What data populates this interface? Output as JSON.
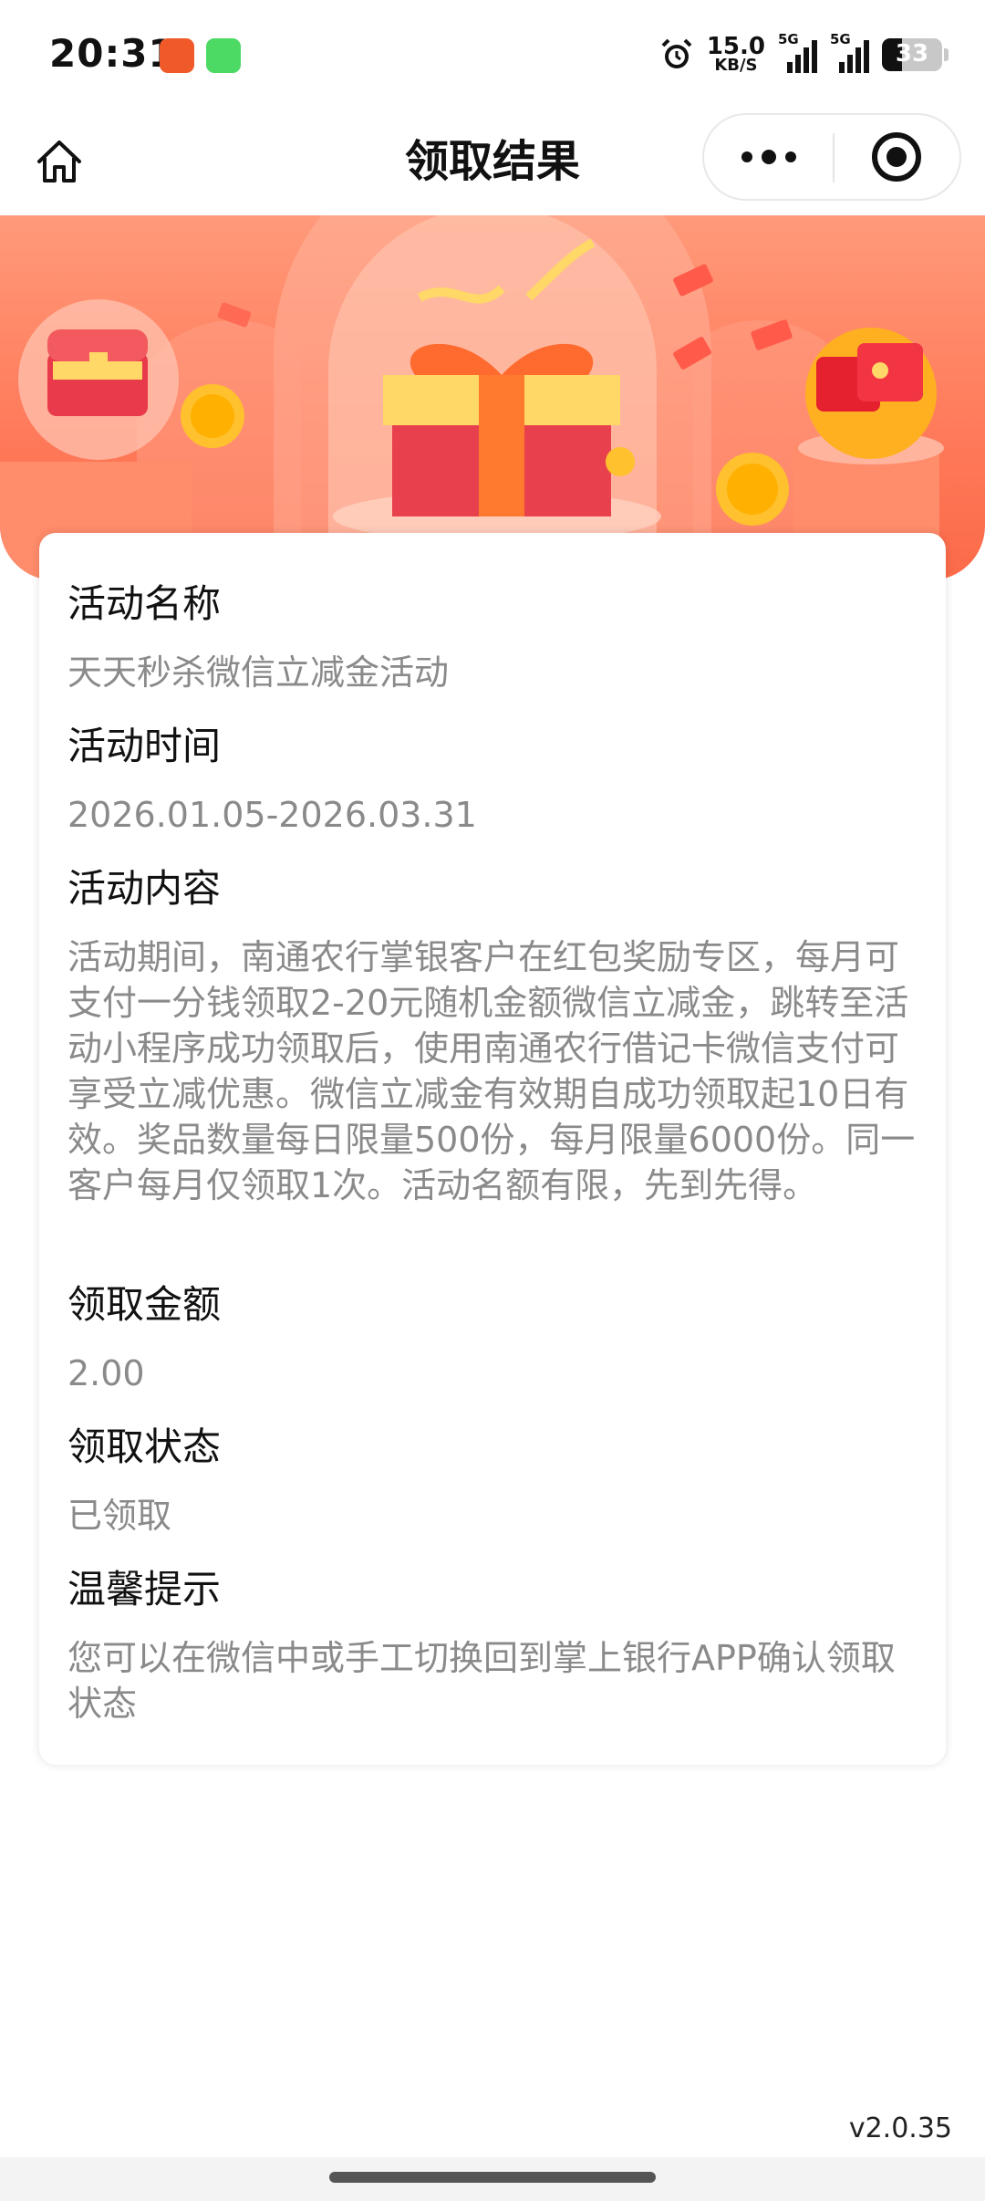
{
  "status_bar": {
    "time": "20:31",
    "net_speed_value": "15.0",
    "net_speed_unit": "KB/S",
    "signal1_label": "5G",
    "signal2_label": "5G",
    "battery": "33"
  },
  "nav": {
    "title": "领取结果"
  },
  "sections": [
    {
      "title": "活动名称",
      "value": "天天秒杀微信立减金活动"
    },
    {
      "title": "活动时间",
      "value": "2026.01.05-2026.03.31"
    },
    {
      "title": "活动内容",
      "value": "活动期间，南通农行掌银客户在红包奖励专区，每月可支付一分钱领取2-20元随机金额微信立减金，跳转至活动小程序成功领取后，使用南通农行借记卡微信支付可享受立减优惠。微信立减金有效期自成功领取起10日有效。奖品数量每日限量500份，每月限量6000份。同一客户每月仅领取1次。活动名额有限，先到先得。"
    },
    {
      "title": "领取金额",
      "value": "2.00"
    },
    {
      "title": "领取状态",
      "value": "已领取"
    },
    {
      "title": "温馨提示",
      "value": "您可以在微信中或手工切换回到掌上银行APP确认领取状态"
    }
  ],
  "version": "v2.0.35",
  "colors": {
    "banner_top": "#ff9a7a",
    "banner_bottom": "#fb6a48",
    "title_text": "#111111",
    "value_text": "#8a8a8a"
  }
}
